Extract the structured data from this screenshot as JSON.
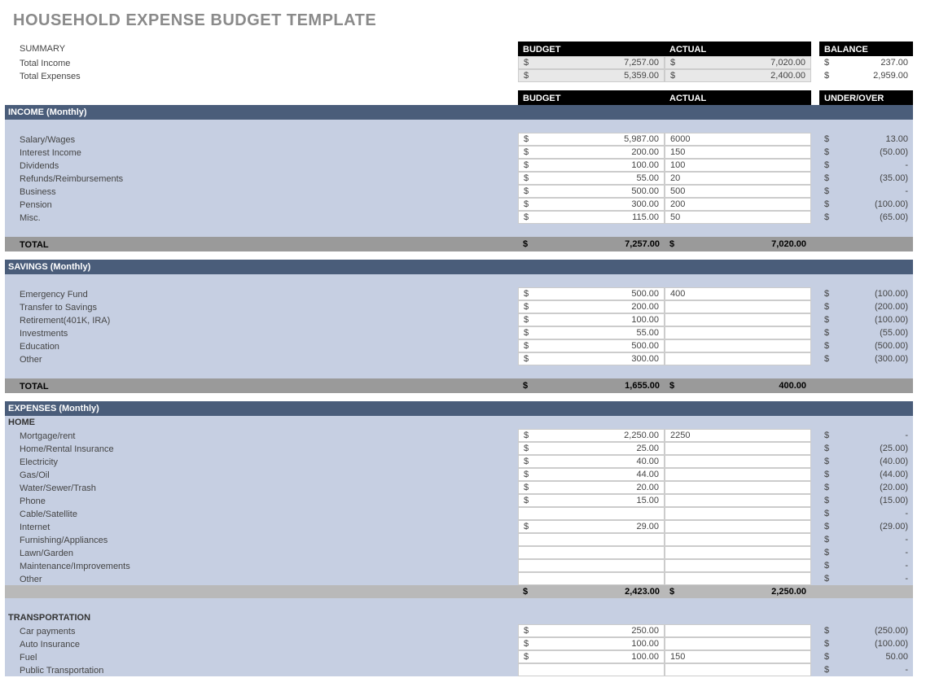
{
  "title": "HOUSEHOLD EXPENSE BUDGET TEMPLATE",
  "summary": {
    "label": "SUMMARY",
    "headers": {
      "budget": "BUDGET",
      "actual": "ACTUAL",
      "balance": "BALANCE"
    },
    "rows": [
      {
        "label": "Total Income",
        "budget": "7,257.00",
        "actual": "7,020.00",
        "balance": "237.00"
      },
      {
        "label": "Total Expenses",
        "budget": "5,359.00",
        "actual": "2,400.00",
        "balance": "2,959.00"
      }
    ]
  },
  "col_headers": {
    "budget": "BUDGET",
    "actual": "ACTUAL",
    "underover": "UNDER/OVER"
  },
  "income": {
    "title": "INCOME (Monthly)",
    "rows": [
      {
        "label": "Salary/Wages",
        "budget": "5,987.00",
        "actual": "6000",
        "uo": "13.00"
      },
      {
        "label": "Interest Income",
        "budget": "200.00",
        "actual": "150",
        "uo": "(50.00)"
      },
      {
        "label": "Dividends",
        "budget": "100.00",
        "actual": "100",
        "uo": "-"
      },
      {
        "label": "Refunds/Reimbursements",
        "budget": "55.00",
        "actual": "20",
        "uo": "(35.00)"
      },
      {
        "label": "Business",
        "budget": "500.00",
        "actual": "500",
        "uo": "-"
      },
      {
        "label": "Pension",
        "budget": "300.00",
        "actual": "200",
        "uo": "(100.00)"
      },
      {
        "label": "Misc.",
        "budget": "115.00",
        "actual": "50",
        "uo": "(65.00)"
      }
    ],
    "total": {
      "label": "TOTAL",
      "budget": "7,257.00",
      "actual": "7,020.00"
    }
  },
  "savings": {
    "title": "SAVINGS (Monthly)",
    "rows": [
      {
        "label": "Emergency Fund",
        "budget": "500.00",
        "actual": "400",
        "uo": "(100.00)"
      },
      {
        "label": "Transfer to Savings",
        "budget": "200.00",
        "actual": "",
        "uo": "(200.00)"
      },
      {
        "label": "Retirement(401K, IRA)",
        "budget": "100.00",
        "actual": "",
        "uo": "(100.00)"
      },
      {
        "label": "Investments",
        "budget": "55.00",
        "actual": "",
        "uo": "(55.00)"
      },
      {
        "label": "Education",
        "budget": "500.00",
        "actual": "",
        "uo": "(500.00)"
      },
      {
        "label": "Other",
        "budget": "300.00",
        "actual": "",
        "uo": "(300.00)"
      }
    ],
    "total": {
      "label": "TOTAL",
      "budget": "1,655.00",
      "actual": "400.00"
    }
  },
  "expenses": {
    "title": "EXPENSES (Monthly)",
    "home": {
      "heading": "HOME",
      "rows": [
        {
          "label": "Mortgage/rent",
          "budget": "2,250.00",
          "actual": "2250",
          "uo": "-"
        },
        {
          "label": "Home/Rental Insurance",
          "budget": "25.00",
          "actual": "",
          "uo": "(25.00)"
        },
        {
          "label": "Electricity",
          "budget": "40.00",
          "actual": "",
          "uo": "(40.00)"
        },
        {
          "label": "Gas/Oil",
          "budget": "44.00",
          "actual": "",
          "uo": "(44.00)"
        },
        {
          "label": "Water/Sewer/Trash",
          "budget": "20.00",
          "actual": "",
          "uo": "(20.00)"
        },
        {
          "label": "Phone",
          "budget": "15.00",
          "actual": "",
          "uo": "(15.00)"
        },
        {
          "label": "Cable/Satellite",
          "budget": "",
          "actual": "",
          "uo": "-"
        },
        {
          "label": "Internet",
          "budget": "29.00",
          "actual": "",
          "uo": "(29.00)"
        },
        {
          "label": "Furnishing/Appliances",
          "budget": "",
          "actual": "",
          "uo": "-"
        },
        {
          "label": "Lawn/Garden",
          "budget": "",
          "actual": "",
          "uo": "-"
        },
        {
          "label": "Maintenance/Improvements",
          "budget": "",
          "actual": "",
          "uo": "-"
        },
        {
          "label": "Other",
          "budget": "",
          "actual": "",
          "uo": "-"
        }
      ],
      "subtotal": {
        "budget": "2,423.00",
        "actual": "2,250.00"
      }
    },
    "transport": {
      "heading": "TRANSPORTATION",
      "rows": [
        {
          "label": "Car payments",
          "budget": "250.00",
          "actual": "",
          "uo": "(250.00)"
        },
        {
          "label": "Auto Insurance",
          "budget": "100.00",
          "actual": "",
          "uo": "(100.00)"
        },
        {
          "label": "Fuel",
          "budget": "100.00",
          "actual": "150",
          "uo": "50.00"
        },
        {
          "label": "Public Transportation",
          "budget": "",
          "actual": "",
          "uo": "-"
        }
      ]
    }
  },
  "dlr": "$"
}
